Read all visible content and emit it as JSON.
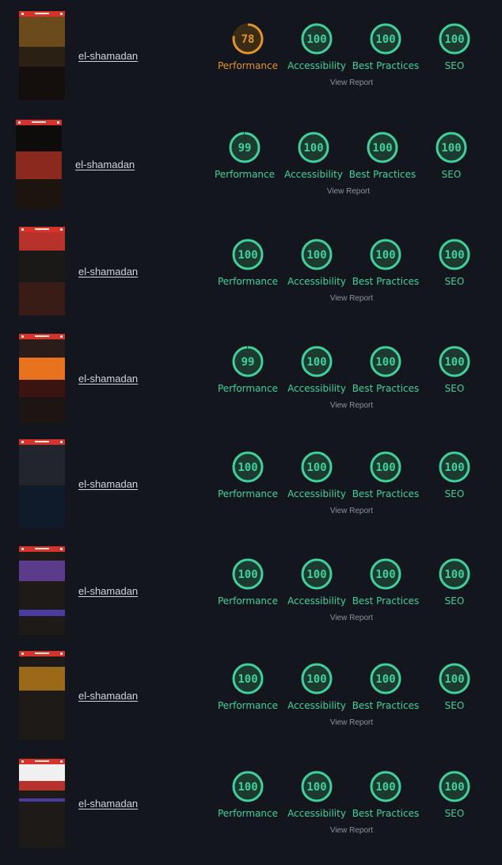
{
  "colors": {
    "pass": "#3ed19b",
    "average": "#e09526",
    "background": "#13171d"
  },
  "labels": [
    "Performance",
    "Accessibility",
    "Best Practices",
    "SEO"
  ],
  "reports": [
    {
      "site": "el-shamadan",
      "scores": [
        78,
        100,
        100,
        100
      ],
      "view_report": "View Report"
    },
    {
      "site": "el-shamadan",
      "scores": [
        99,
        100,
        100,
        100
      ],
      "view_report": "View Report"
    },
    {
      "site": "el-shamadan",
      "scores": [
        100,
        100,
        100,
        100
      ],
      "view_report": "View Report"
    },
    {
      "site": "el-shamadan",
      "scores": [
        99,
        100,
        100,
        100
      ],
      "view_report": "View Report"
    },
    {
      "site": "el-shamadan",
      "scores": [
        100,
        100,
        100,
        100
      ],
      "view_report": "View Report"
    },
    {
      "site": "el-shamadan",
      "scores": [
        100,
        100,
        100,
        100
      ],
      "view_report": "View Report"
    },
    {
      "site": "el-shamadan",
      "scores": [
        100,
        100,
        100,
        100
      ],
      "view_report": "View Report"
    },
    {
      "site": "el-shamadan",
      "scores": [
        100,
        100,
        100,
        100
      ],
      "view_report": "View Report"
    }
  ]
}
